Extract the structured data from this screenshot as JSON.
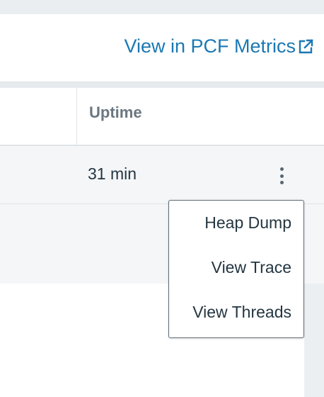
{
  "header": {
    "link_label": "View in PCF Metrics",
    "link_icon": "external-link-icon"
  },
  "table": {
    "columns": [
      "Uptime"
    ],
    "rows": [
      {
        "uptime": "31 min",
        "actions_icon": "kebab-menu-icon"
      }
    ]
  },
  "actions_menu": {
    "items": [
      "Heap Dump",
      "View Trace",
      "View Threads"
    ]
  },
  "colors": {
    "link": "#1b78b3",
    "text": "#243641",
    "header_text": "#6b7780",
    "menu_border": "#5d6b74"
  }
}
